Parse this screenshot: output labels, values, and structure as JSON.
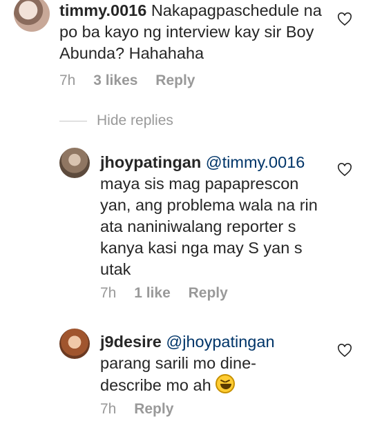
{
  "comments": [
    {
      "username": "timmy.0016",
      "text": "Nakapagpaschedule na po ba kayo ng interview kay sir Boy Abunda? Hahahaha",
      "time": "7h",
      "likes": "3 likes",
      "reply": "Reply"
    },
    {
      "username": "jhoypatingan",
      "mention": "@timmy.0016",
      "text": "maya sis mag papaprescon yan, ang problema wala na rin ata naniniwalang reporter s kanya kasi nga may S yan s utak",
      "time": "7h",
      "likes": "1 like",
      "reply": "Reply"
    },
    {
      "username": "j9desire",
      "mention": "@jhoypatingan",
      "text": "parang sarili mo dine-describe mo ah",
      "emoji": "laughing-face-emoji",
      "time": "7h",
      "reply": "Reply"
    }
  ],
  "hide_replies": "Hide replies",
  "icons": {
    "like": "heart-outline-icon"
  },
  "colors": {
    "text": "#262626",
    "meta": "#999999",
    "mention": "#003569"
  }
}
